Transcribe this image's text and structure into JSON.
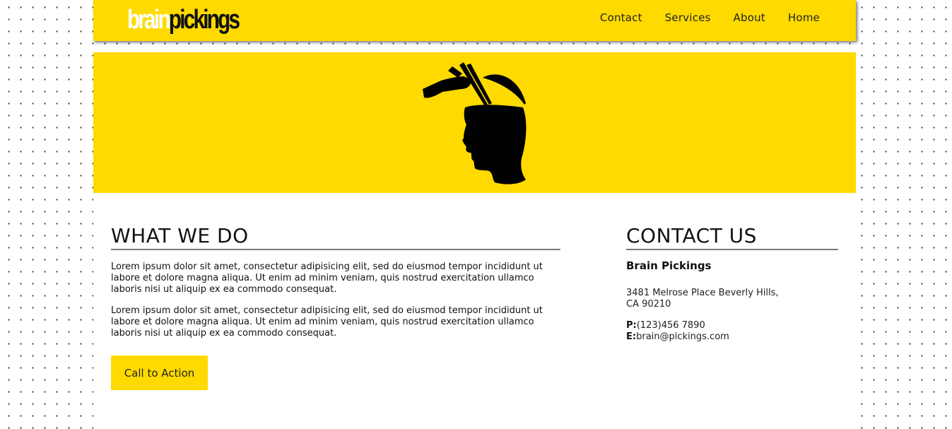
{
  "header": {
    "logo_part1": "brain",
    "logo_part2": "pickings",
    "nav": [
      {
        "label": "Home"
      },
      {
        "label": "About"
      },
      {
        "label": "Services"
      },
      {
        "label": "Contact"
      }
    ]
  },
  "hero": {
    "illustration": "open-head-with-hand-icon"
  },
  "what_we_do": {
    "heading": "WHAT WE DO",
    "paragraph1": "Lorem ipsum dolor sit amet, consectetur adipisicing elit, sed do eiusmod tempor incididunt ut labore et dolore magna aliqua. Ut enim ad minim veniam, quis nostrud exercitation ullamco laboris nisi ut aliquip ex ea commodo consequat.",
    "paragraph2": "Lorem ipsum dolor sit amet, consectetur adipisicing elit, sed do eiusmod tempor incididunt ut labore et dolore magna aliqua. Ut enim ad minim veniam, quis nostrud exercitation ullamco laboris nisi ut aliquip ex ea commodo consequat.",
    "cta_label": "Call to Action"
  },
  "contact_us": {
    "heading": "CONTACT US",
    "company": "Brain Pickings",
    "address_line1": "3481 Melrose Place Beverly Hills,",
    "address_line2": "CA 90210",
    "phone_label": "P:",
    "phone": "(123)456 7890",
    "email_label": "E:",
    "email": "brain@pickings.com"
  },
  "colors": {
    "brand_yellow": "#ffda00",
    "text_dark": "#111111",
    "rule_gray": "#7a7a7a"
  }
}
